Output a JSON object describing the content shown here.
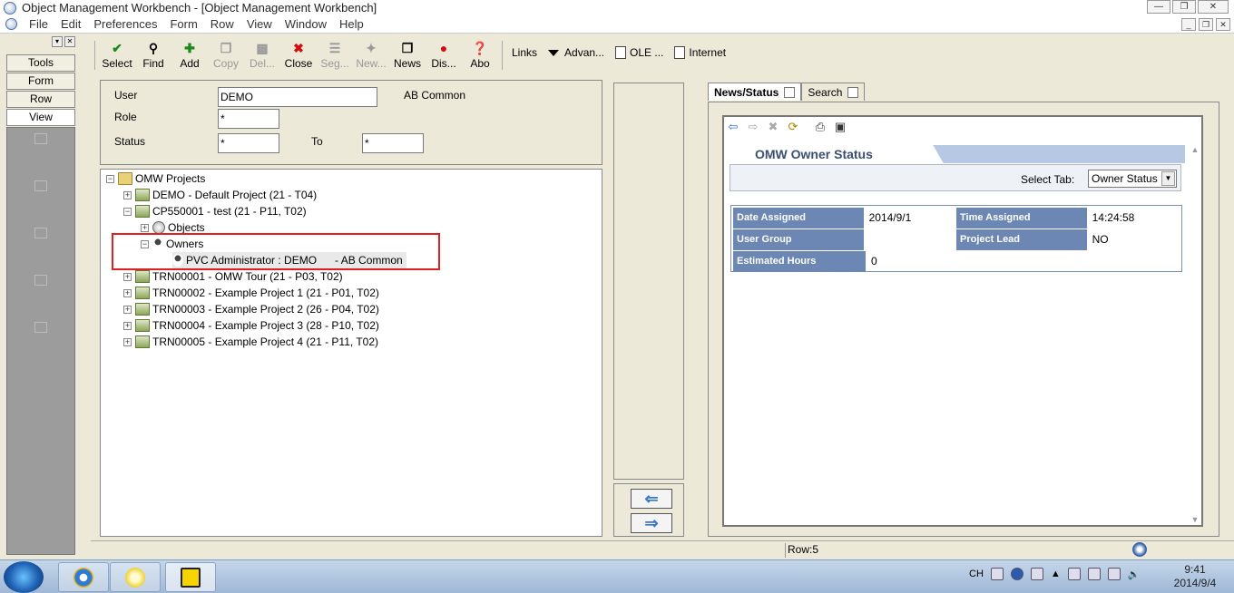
{
  "window": {
    "title": "Object Management Workbench - [Object Management Workbench]"
  },
  "menu": [
    "File",
    "Edit",
    "Preferences",
    "Form",
    "Row",
    "View",
    "Window",
    "Help"
  ],
  "sidebar": {
    "items": [
      "Tools",
      "Form",
      "Row",
      "View"
    ]
  },
  "toolbar": {
    "buttons": [
      {
        "label": "Select",
        "icon": "check-icon",
        "enabled": true
      },
      {
        "label": "Find",
        "icon": "find-icon",
        "enabled": true
      },
      {
        "label": "Add",
        "icon": "plus-icon",
        "enabled": true
      },
      {
        "label": "Copy",
        "icon": "copy-icon",
        "enabled": false
      },
      {
        "label": "Del...",
        "icon": "trash-icon",
        "enabled": false
      },
      {
        "label": "Close",
        "icon": "x-icon",
        "enabled": true
      },
      {
        "label": "Seg...",
        "icon": "segment-icon",
        "enabled": false
      },
      {
        "label": "New...",
        "icon": "new-icon",
        "enabled": false
      },
      {
        "label": "News",
        "icon": "book-icon",
        "enabled": true
      },
      {
        "label": "Dis...",
        "icon": "dis-icon",
        "enabled": true
      },
      {
        "label": "Abo",
        "icon": "about-icon",
        "enabled": true
      }
    ],
    "links": "Links",
    "advanced": "Advan...",
    "ole": "OLE ...",
    "internet": "Internet"
  },
  "filter": {
    "user_label": "User",
    "user_value": "DEMO",
    "user_desc": "AB Common",
    "role_label": "Role",
    "role_value": "*",
    "status_label": "Status",
    "status_value": "*",
    "to_label": "To",
    "to_value": "*"
  },
  "tree": {
    "root": "OMW Projects",
    "demo": "DEMO - Default Project (21 - T04)",
    "cp": "CP550001 - test (21 - P11, T02)",
    "objects": "Objects",
    "owners": "Owners",
    "owner_item": "PVC Administrator : DEMO      - AB Common",
    "trn1": "TRN00001 - OMW Tour (21 - P03, T02)",
    "trn2": "TRN00002 - Example Project 1 (21 - P01, T02)",
    "trn3": "TRN00003 - Example Project 2 (26 - P04, T02)",
    "trn4": "TRN00004 - Example Project 3 (28 - P10, T02)",
    "trn5": "TRN00005 - Example Project 4 (21 - P11, T02)"
  },
  "right": {
    "tabs": [
      "News/Status",
      "Search"
    ],
    "owner_title": "OMW Owner Status",
    "select_tab_label": "Select Tab:",
    "select_tab_value": "Owner Status",
    "fields": {
      "date_assigned_label": "Date Assigned",
      "date_assigned": "2014/9/1",
      "time_assigned_label": "Time Assigned",
      "time_assigned": "14:24:58",
      "user_group_label": "User Group",
      "user_group": "",
      "project_lead_label": "Project Lead",
      "project_lead": "NO",
      "est_hours_label": "Estimated Hours",
      "est_hours": "0"
    }
  },
  "statusbar": {
    "row": "Row:5"
  },
  "taskbar": {
    "ime": "CH",
    "time": "9:41",
    "date": "2014/9/4"
  },
  "colors": {
    "header_blue": "#6c87b4",
    "highlight_red": "#e02020"
  }
}
